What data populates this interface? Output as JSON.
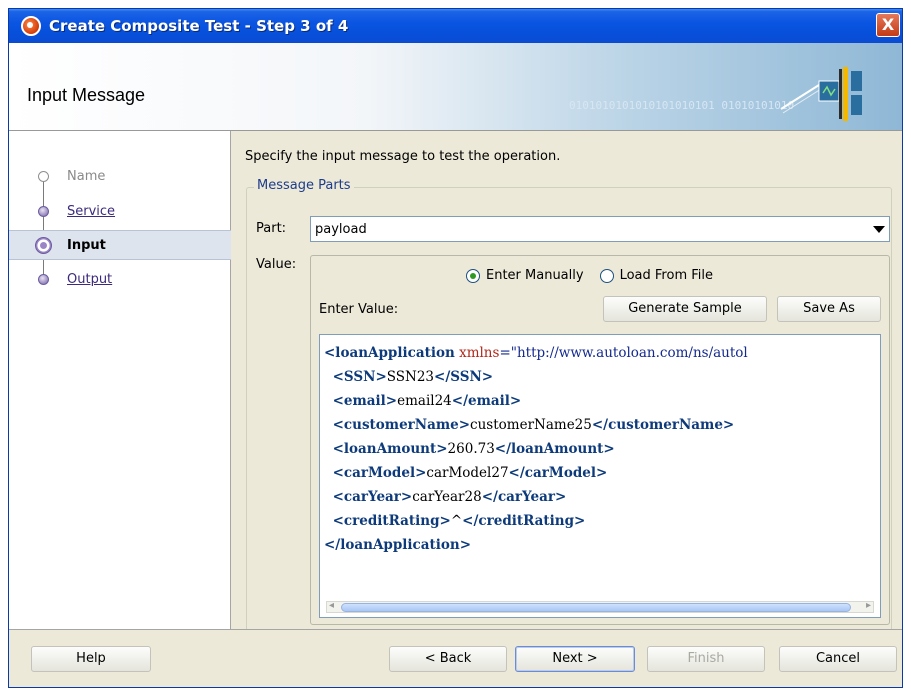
{
  "window": {
    "title": "Create Composite Test - Step 3 of 4",
    "close_glyph": "X"
  },
  "banner": {
    "title": "Input Message",
    "binary": "0101010101010101010101 01010101010"
  },
  "nav": {
    "items": [
      {
        "label": "Name",
        "state": "done"
      },
      {
        "label": "Service",
        "state": "link"
      },
      {
        "label": "Input",
        "state": "current"
      },
      {
        "label": "Output",
        "state": "link"
      }
    ]
  },
  "main": {
    "instruction": "Specify the input message to test the operation.",
    "group_title": "Message Parts",
    "part_label": "Part:",
    "part_value": "payload",
    "value_label": "Value:",
    "radio_manual": "Enter Manually",
    "radio_file": "Load From File",
    "radio_selected": "Enter Manually",
    "enter_value_label": "Enter Value:",
    "generate_sample": "Generate Sample",
    "save_as": "Save As",
    "xml": {
      "root_open": "loanApplication",
      "xmlns_attr": "xmlns",
      "xmlns_value": "\"http://www.autoloan.com/ns/autol",
      "fields": [
        {
          "tag": "SSN",
          "value": "SSN23"
        },
        {
          "tag": "email",
          "value": "email24"
        },
        {
          "tag": "customerName",
          "value": "customerName25"
        },
        {
          "tag": "loanAmount",
          "value": "260.73"
        },
        {
          "tag": "carModel",
          "value": "carModel27"
        },
        {
          "tag": "carYear",
          "value": "carYear28"
        },
        {
          "tag": "creditRating",
          "value": "^"
        }
      ],
      "root_close": "loanApplication"
    }
  },
  "buttons": {
    "help": "Help",
    "back": "< Back",
    "next": "Next >",
    "finish": "Finish",
    "cancel": "Cancel"
  },
  "colors": {
    "titlebar": "#0a55e2",
    "link": "#3d2a7c",
    "xml_tag": "#0d3a7a",
    "xml_attr": "#b0281a"
  }
}
